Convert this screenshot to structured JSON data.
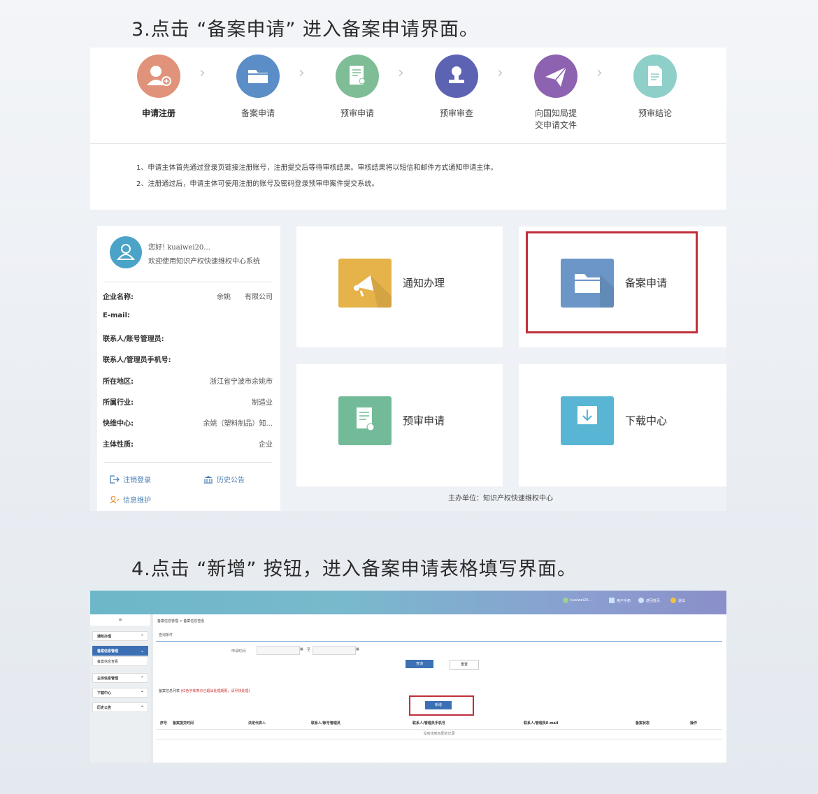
{
  "section3": {
    "heading": "3.点击 “备案申请” 进入备案申请界面。",
    "steps": [
      {
        "label": "申请注册",
        "icon": "register-user-icon",
        "color": "#e0937a"
      },
      {
        "label": "备案申请",
        "icon": "folder-icon",
        "color": "#5b8ec7"
      },
      {
        "label": "预审申请",
        "icon": "document-user-icon",
        "color": "#7ebd95"
      },
      {
        "label": "预审审查",
        "icon": "stamp-icon",
        "color": "#5d63b3"
      },
      {
        "label": "向国知局提交申请文件",
        "label_line1": "向国知局提",
        "label_line2": "交申请文件",
        "icon": "paper-plane-icon",
        "color": "#8d62b0"
      },
      {
        "label": "预审结论",
        "icon": "document-icon",
        "color": "#8fcfc9"
      }
    ],
    "notes": [
      "1、申请主体首先通过登录页链接注册账号，注册提交后等待审核结果。审核结果将以短信和邮件方式通知申请主体。",
      "2、注册通过后，申请主体可使用注册的账号及密码登录预审申案件提交系统。"
    ],
    "user": {
      "greeting": "您好! kuaiwei20...",
      "welcome": "欢迎使用知识产权快速维权中心系统",
      "fields": [
        {
          "key": "企业名称:",
          "value": "余姚　　有限公司"
        },
        {
          "key": "E-mail:",
          "value": ""
        },
        {
          "key": "联系人/账号管理员:",
          "value": ""
        },
        {
          "key": "联系人/管理员手机号:",
          "value": ""
        },
        {
          "key": "所在地区:",
          "value": "浙江省宁波市余姚市"
        },
        {
          "key": "所属行业:",
          "value": "制造业"
        },
        {
          "key": "快维中心:",
          "value": "余姚（塑料制品）知..."
        },
        {
          "key": "主体性质:",
          "value": "企业"
        }
      ],
      "links": {
        "logout": "注销登录",
        "history": "历史公告",
        "info": "信息维护"
      }
    },
    "tiles": [
      {
        "name": "通知办理",
        "icon": "megaphone-icon",
        "color": "#e6b24a"
      },
      {
        "name": "备案申请",
        "icon": "folder-icon",
        "color": "#6b96c7"
      },
      {
        "name": "预审申请",
        "icon": "document-user-icon",
        "color": "#73bb98"
      },
      {
        "name": "下载中心",
        "icon": "download-icon",
        "color": "#58b5d3"
      }
    ],
    "footer": "主办单位：知识产权快速维权中心"
  },
  "section4": {
    "heading": "4.点击 “新增” 按钮，进入备案申请表格填写界面。",
    "topbar": {
      "user": "kuaiwei20...",
      "manual": "用户手册",
      "home": "返回首页",
      "exit": "退出"
    },
    "sidebar": [
      {
        "label": "通知办理",
        "active": false
      },
      {
        "label": "备案信息管理",
        "active": true
      },
      {
        "label": "备案信息查看",
        "sub": true
      },
      {
        "label": "主体信息管理",
        "active": false
      },
      {
        "label": "下载中心",
        "active": false
      },
      {
        "label": "历史公告",
        "active": false
      }
    ],
    "breadcrumb": "备案信息管理 > 备案信息查看",
    "query_title": "查询条件",
    "query_label": "申请时间:",
    "query_to": "至",
    "query_button": "查询",
    "reset_button": "重置",
    "list_title": "备案信息列表",
    "list_warning": "(红色字体表示已超出处理期限，请尽快处理)",
    "add_button": "新增",
    "columns": [
      "序号",
      "备案提交时间",
      "法定代表人",
      "联系人/账号管理员",
      "联系人/管理员手机号",
      "联系人/管理员E-mail",
      "备案状态",
      "操作"
    ],
    "empty": "没有找到匹配的记录"
  }
}
